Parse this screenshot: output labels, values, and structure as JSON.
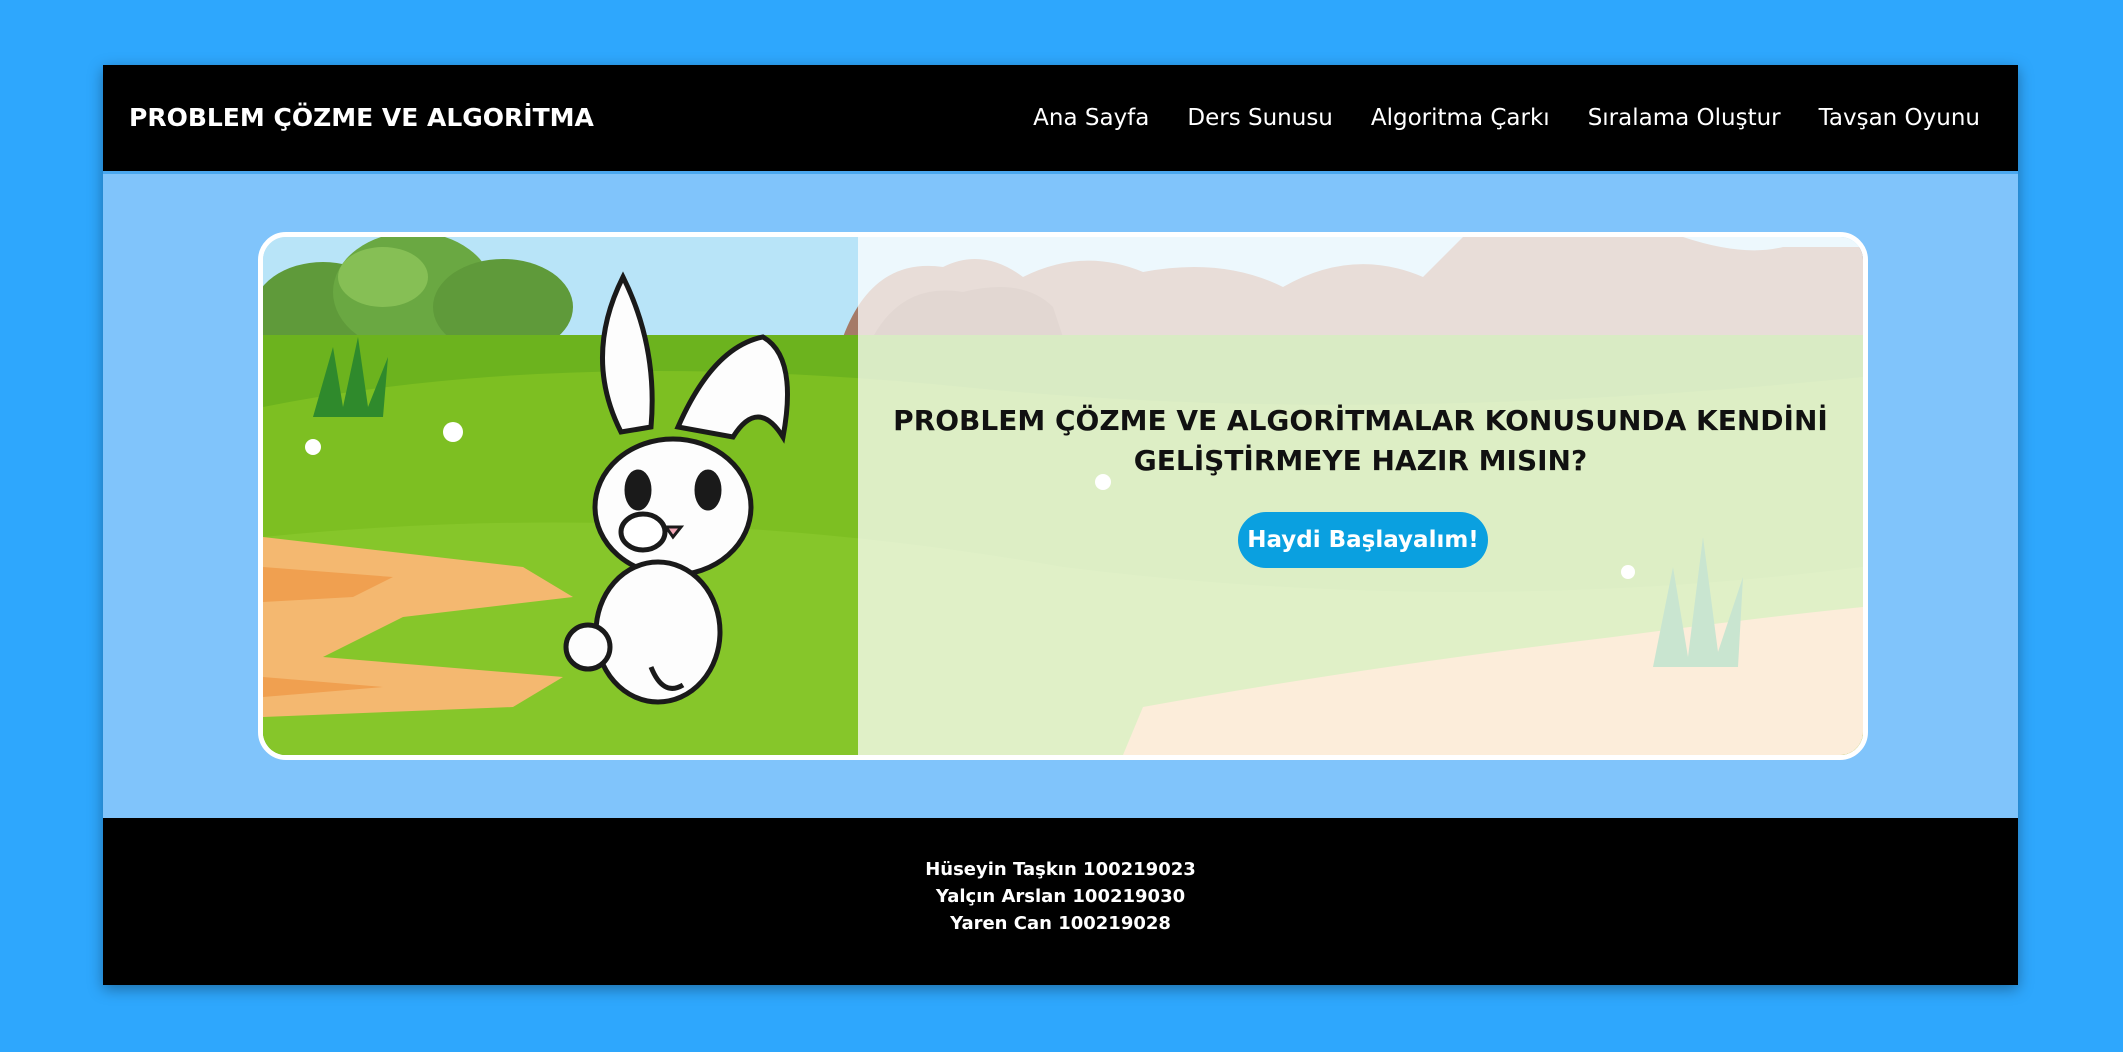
{
  "header": {
    "brand": "PROBLEM ÇÖZME VE ALGORİTMA",
    "nav": [
      {
        "label": "Ana Sayfa"
      },
      {
        "label": "Ders Sunusu"
      },
      {
        "label": "Algoritma Çarkı"
      },
      {
        "label": "Sıralama Oluştur"
      },
      {
        "label": "Tavşan Oyunu"
      }
    ]
  },
  "hero": {
    "title_line1": "PROBLEM ÇÖZME VE ALGORİTMALAR KONUSUNDA KENDİNİ",
    "title_line2": "GELİŞTİRMEYE HAZIR MISIN?",
    "cta_label": "Haydi Başlayalım!"
  },
  "footer": {
    "credits": [
      "Hüseyin Taşkın 100219023",
      "Yalçın Arslan 100219030",
      "Yaren Can 100219028"
    ]
  },
  "colors": {
    "page_background": "#2ea7fd",
    "header_background": "#000000",
    "main_background": "#80c4fb",
    "cta_background": "#0aa0e0",
    "grass": "#6cb31e"
  }
}
